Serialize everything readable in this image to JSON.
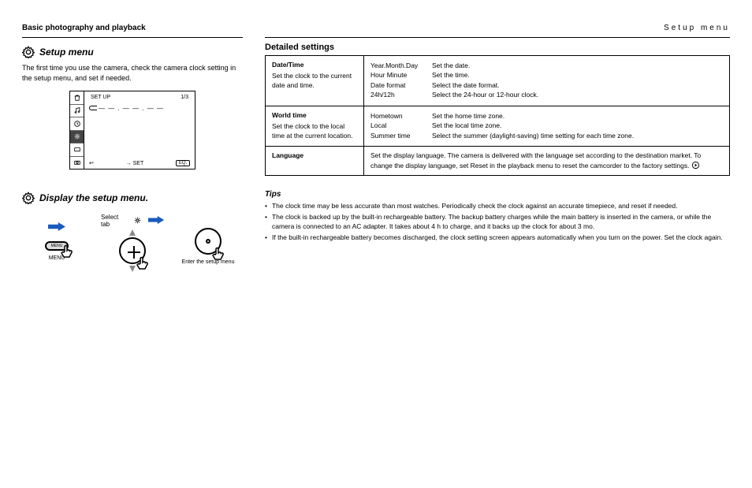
{
  "header": {
    "category_left": "Basic photography and playback",
    "category_right": "Setup menu"
  },
  "section1": {
    "title": "Setup menu",
    "intro": "The first time you use the camera, check the camera clock setting in the setup menu, and set if needed.",
    "lcd": {
      "title_left": "SET UP",
      "title_right": "1/3",
      "option_dashes": "— — . — — . — —",
      "bottom_mid": "→ SET",
      "eq_label": "EQ."
    }
  },
  "section2": {
    "title": "Display the setup menu.",
    "steps": [
      {
        "label": "MENU"
      },
      {
        "label": "Select tab",
        "updown": true
      },
      {
        "label": "Enter the setup menu"
      }
    ]
  },
  "right": {
    "heading": "Detailed settings",
    "table": [
      {
        "name": "Date/Time",
        "desc": "Set the clock to the current date and time.",
        "rows": [
          {
            "opt": "Year.Month.Day",
            "text": "Set the date."
          },
          {
            "opt": "Hour Minute",
            "text": "Set the time."
          },
          {
            "opt": "Date format",
            "text": "Select the date format."
          },
          {
            "opt": "24h/12h",
            "text": "Select the 24-hour or 12-hour clock."
          }
        ]
      },
      {
        "name": "World time",
        "desc": "Set the clock to the local time at the current location.",
        "rows": [
          {
            "opt": "Hometown",
            "text": "Set the home time zone."
          },
          {
            "opt": "Local",
            "text": "Set the local time zone."
          },
          {
            "opt": "Summer time",
            "text": "Select the summer (daylight-saving) time setting for each time zone."
          }
        ]
      },
      {
        "name": "Language",
        "desc_html": "Set the display language. The camera is delivered with the language set according to the destination market. To change the display language, set Reset in the playback menu to reset the camcorder to the factory settings."
      }
    ]
  },
  "tips": {
    "title": "Tips",
    "items": [
      "The clock time may be less accurate than most watches. Periodically check the clock against an accurate timepiece, and reset if needed.",
      "The clock is backed up by the built-in rechargeable battery. The backup battery charges while the main battery is inserted in the camera, or while the camera is connected to an AC adapter. It takes about 4 h to charge, and it backs up the clock for about 3 mo.",
      "If the built-in rechargeable battery becomes discharged, the clock setting screen appears automatically when you turn on the power. Set the clock again."
    ]
  }
}
